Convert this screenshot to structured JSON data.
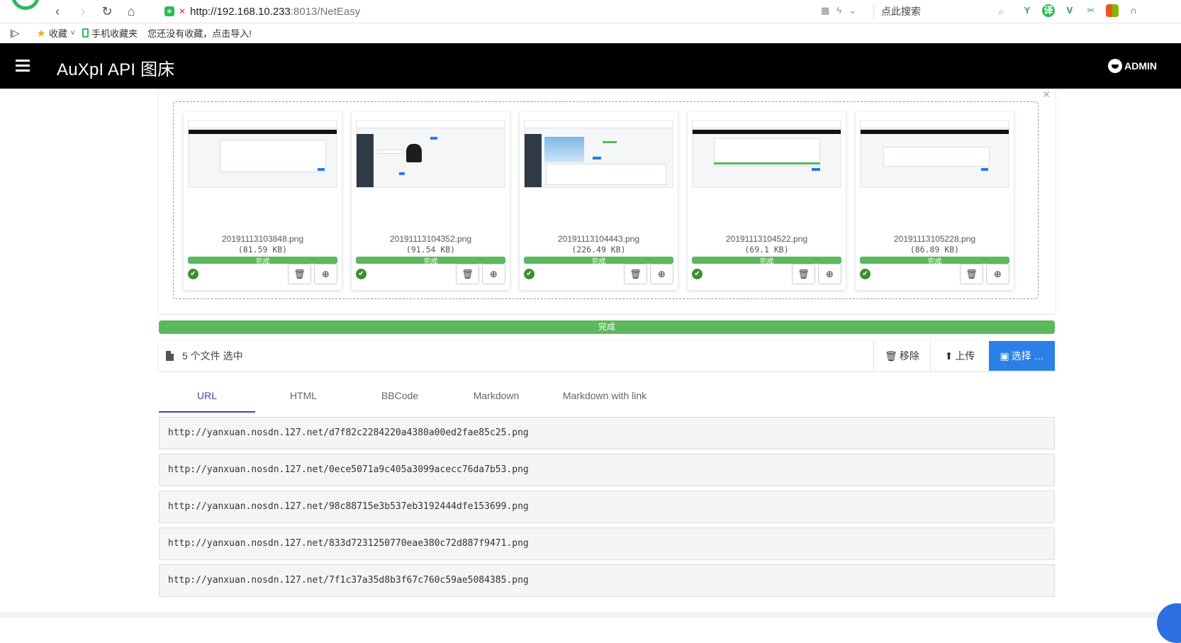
{
  "browser": {
    "url_host": "http://192.168.10.233",
    "url_rest": ":8013/NetEasy",
    "search_placeholder": "点此搜索"
  },
  "bookmarks": {
    "favorites": "收藏",
    "mobile": "手机收藏夹",
    "import_hint": "您还没有收藏，点击导入!"
  },
  "header": {
    "title": "AuXpI API 图床",
    "user": "ADMIN"
  },
  "previews": [
    {
      "name": "20191113103848.png",
      "size": "(81.59 KB)",
      "status": "完成",
      "progress": 100
    },
    {
      "name": "20191113104352.png",
      "size": "(91.54 KB)",
      "status": "完成",
      "progress": 100
    },
    {
      "name": "20191113104443.png",
      "size": "(226.49 KB)",
      "status": "完成",
      "progress": 100
    },
    {
      "name": "20191113104522.png",
      "size": "(69.1 KB)",
      "status": "完成",
      "progress": 100
    },
    {
      "name": "20191113105228.png",
      "size": "(86.89 KB)",
      "status": "完成",
      "progress": 100
    }
  ],
  "overall": {
    "label": "完成",
    "progress": 100
  },
  "file_bar": {
    "caption": "5 个文件 选中",
    "remove_label": "移除",
    "upload_label": "上传",
    "browse_label": "选择 …"
  },
  "tabs": [
    {
      "label": "URL"
    },
    {
      "label": "HTML"
    },
    {
      "label": "BBCode"
    },
    {
      "label": "Markdown"
    },
    {
      "label": "Markdown with link"
    }
  ],
  "links": [
    "http://yanxuan.nosdn.127.net/d7f82c2284220a4380a00ed2fae85c25.png",
    "http://yanxuan.nosdn.127.net/0ece5071a9c405a3099acecc76da7b53.png",
    "http://yanxuan.nosdn.127.net/98c88715e3b537eb3192444dfe153699.png",
    "http://yanxuan.nosdn.127.net/833d7231250770eae380c72d887f9471.png",
    "http://yanxuan.nosdn.127.net/7f1c37a35d8b3f67c760c59ae5084385.png"
  ],
  "colors": {
    "header_bg": "#000000",
    "success": "#5cb85c",
    "primary": "#2b80e8",
    "tab_active": "#3949ab"
  }
}
